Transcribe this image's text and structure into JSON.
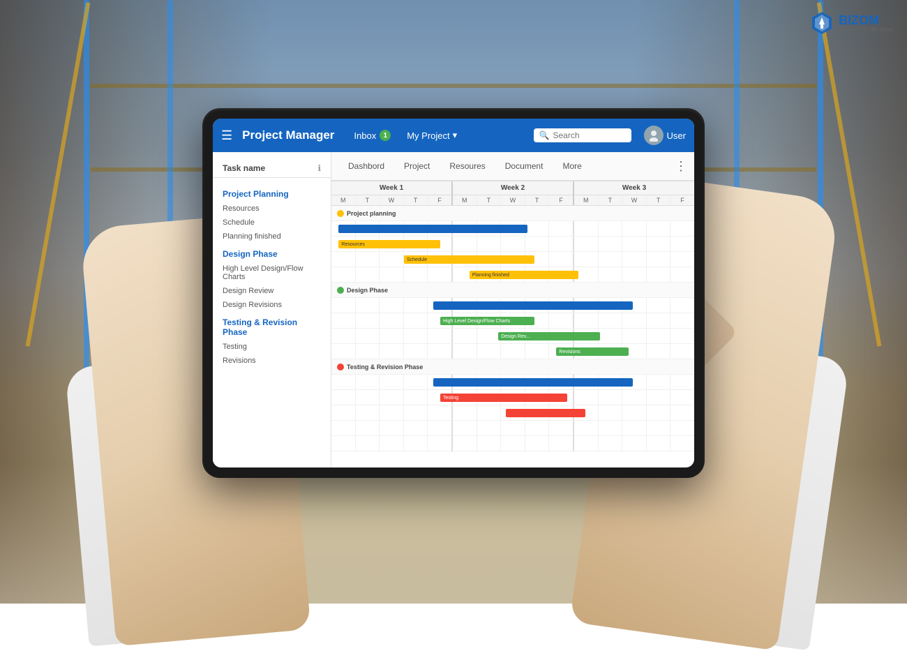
{
  "background": {
    "color": "#A8B8C8"
  },
  "bizom": {
    "name": "BIZOM",
    "tagline": "business on the move"
  },
  "app": {
    "title": "Project Manager",
    "header": {
      "menu_icon": "☰",
      "inbox_label": "Inbox",
      "inbox_count": "1",
      "project_label": "My Project",
      "search_placeholder": "Search",
      "user_label": "User"
    },
    "tabs": [
      {
        "label": "Dashbord",
        "active": false
      },
      {
        "label": "Project",
        "active": false
      },
      {
        "label": "Resoures",
        "active": false
      },
      {
        "label": "Document",
        "active": false
      },
      {
        "label": "More",
        "active": false
      }
    ],
    "sidebar": {
      "header": "Task name",
      "sections": [
        {
          "title": "Project Planning",
          "items": [
            "Resources",
            "Schedule",
            "Planning finished"
          ]
        },
        {
          "title": "Design Phase",
          "items": [
            "High Level Design/Flow Charts",
            "Design Review",
            "Design Revisions"
          ]
        },
        {
          "title": "Testing & Revision Phase",
          "items": [
            "Testing",
            "Revisions"
          ]
        }
      ]
    },
    "gantt": {
      "weeks": [
        {
          "label": "Week 1",
          "days": [
            "M",
            "T",
            "W",
            "T",
            "F"
          ]
        },
        {
          "label": "Week 2",
          "days": [
            "M",
            "T",
            "W",
            "T",
            "F"
          ]
        },
        {
          "label": "Week 3",
          "days": [
            "M",
            "T",
            "W",
            "T"
          ]
        }
      ],
      "rows": [
        {
          "type": "section",
          "label": "Project planning",
          "dot_color": "#FFC107"
        },
        {
          "type": "bar",
          "label": "Project planning bar",
          "color": "#1565C0",
          "start_pct": 0,
          "width_pct": 55
        },
        {
          "type": "bar",
          "label": "Resources",
          "color": "#FFC107",
          "start_pct": 0,
          "width_pct": 30,
          "bar_label": "Resources"
        },
        {
          "type": "bar",
          "label": "Schedule",
          "color": "#FFC107",
          "start_pct": 20,
          "width_pct": 35,
          "bar_label": "Schedule"
        },
        {
          "type": "bar",
          "label": "Planning finished",
          "color": "#FFC107",
          "start_pct": 35,
          "width_pct": 30,
          "bar_label": "Planning finished"
        },
        {
          "type": "section",
          "label": "Design Phase",
          "dot_color": "#4CAF50"
        },
        {
          "type": "bar",
          "label": "Design Phase bar",
          "color": "#1565C0",
          "start_pct": 30,
          "width_pct": 55
        },
        {
          "type": "bar",
          "label": "High Level Design",
          "color": "#4CAF50",
          "start_pct": 30,
          "width_pct": 25,
          "bar_label": "High Level Design/Flow Charts"
        },
        {
          "type": "bar",
          "label": "Design Review",
          "color": "#4CAF50",
          "start_pct": 45,
          "width_pct": 28,
          "bar_label": "Design Rev..."
        },
        {
          "type": "bar",
          "label": "Design Revisions",
          "color": "#4CAF50",
          "start_pct": 60,
          "width_pct": 20,
          "bar_label": "Revisions"
        },
        {
          "type": "section",
          "label": "Testing & Revision Phase",
          "dot_color": "#F44336"
        },
        {
          "type": "bar",
          "label": "Testing & Revision bar",
          "color": "#1565C0",
          "start_pct": 30,
          "width_pct": 55
        },
        {
          "type": "bar",
          "label": "Testing bar",
          "color": "#F44336",
          "start_pct": 30,
          "width_pct": 35,
          "bar_label": "Testing"
        },
        {
          "type": "bar",
          "label": "Revisions bar",
          "color": "#F44336",
          "start_pct": 45,
          "width_pct": 25,
          "bar_label": ""
        }
      ]
    }
  }
}
